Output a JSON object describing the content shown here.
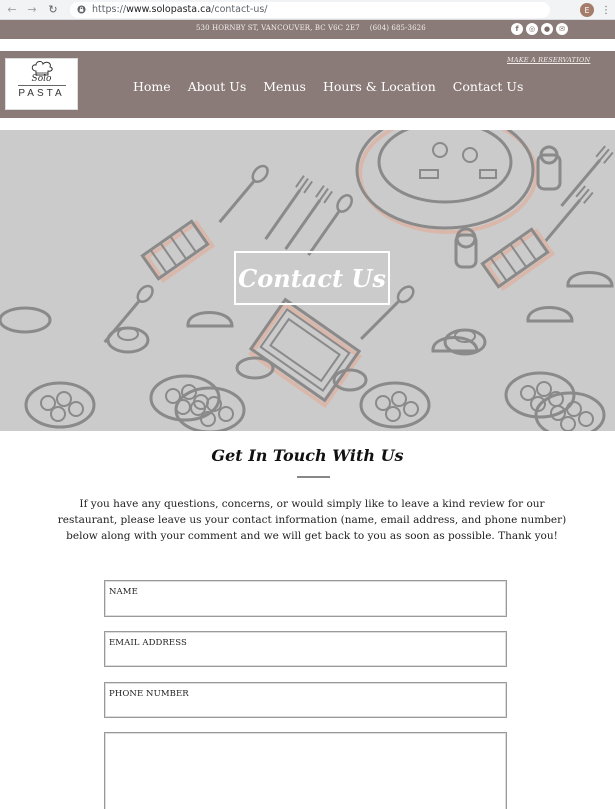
{
  "browser": {
    "url_prefix": "https://",
    "url_host": "www.solopasta.ca",
    "url_path": "/contact-us/",
    "profile_initial": "E",
    "back_icon": "arrow-left-icon",
    "forward_icon": "arrow-right-icon",
    "reload_icon": "reload-icon",
    "lock_icon": "lock-icon",
    "menu_icon": "vertical-dots-icon"
  },
  "topbar": {
    "address": "530 HORNBY ST, VANCOUVER, BC V6C 2E7",
    "phone": "(604) 685-3626",
    "socials": [
      {
        "icon": "facebook-icon",
        "glyph": "f"
      },
      {
        "icon": "instagram-icon",
        "glyph": "◎"
      },
      {
        "icon": "foursquare-icon",
        "glyph": "●"
      },
      {
        "icon": "email-icon",
        "glyph": "✉"
      }
    ]
  },
  "header": {
    "reservation_link": "MAKE A RESERVATION",
    "logo": {
      "script": "Solo",
      "word": "PASTA",
      "icon": "chef-hat-icon"
    },
    "nav": [
      {
        "label": "Home"
      },
      {
        "label": "About Us"
      },
      {
        "label": "Menus"
      },
      {
        "label": "Hours & Location"
      },
      {
        "label": "Contact Us"
      }
    ]
  },
  "hero": {
    "title": "Contact Us"
  },
  "content": {
    "heading": "Get In Touch With Us",
    "intro": "If  you have any questions, concerns, or would simply like to leave a kind review for our restaurant, please leave us your contact information (name, email address, and phone number) below along with your comment and we will get back to you as soon as possible. Thank you!"
  },
  "form": {
    "name_label": "NAME",
    "email_label": "EMAIL ADDRESS",
    "phone_label": "PHONE NUMBER"
  },
  "colors": {
    "brand": "#8a7b78",
    "hero_bg": "#cbcbcb",
    "illustration": "#8a8a8a",
    "illustration_shadow": "#d9b8ab"
  }
}
